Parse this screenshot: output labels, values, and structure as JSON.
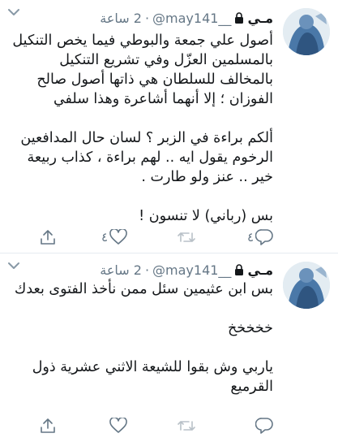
{
  "tweets": [
    {
      "display_name": "مـي",
      "handle": "@may141__",
      "separator": "·",
      "time": "2 ساعة",
      "body": [
        "أصول علي جمعة والبوطي فيما يخص التنكيل بالمسلمين العزّل وفي تشريع التنكيل بالمخالف للسلطان هي ذاتها أصول صالح الفوزان ؛ إلا أنهما أشاعرة وهذا سلفي",
        "ألكم براءة في الزبر ؟ لسان حال المدافعين الرخوم يقول ايه .. لهم براءة ، كذاب ربيعة خير .. عنز ولو طارت .",
        "بس (رباني) لا تنسون !"
      ],
      "reply_count": "٤",
      "retweet_count": "",
      "like_count": "٤"
    },
    {
      "display_name": "مـي",
      "handle": "@may141__",
      "separator": "·",
      "time": "2 ساعة",
      "body": [
        "بس ابن عثيمين سئل ممن نأخذ الفتوى بعدك",
        "خخخخخ",
        "ياربي وش بقوا للشيعة الاثني عشرية ذول القرميع"
      ],
      "reply_count": "",
      "retweet_count": "",
      "like_count": ""
    }
  ],
  "icons": {
    "menu": "chevron-down-icon",
    "lock": "lock-icon",
    "reply": "reply-icon",
    "retweet": "retweet-icon",
    "like": "heart-icon",
    "share": "share-icon"
  },
  "colors": {
    "text": "#14171a",
    "muted": "#657786",
    "divider": "#e6ecf0"
  }
}
